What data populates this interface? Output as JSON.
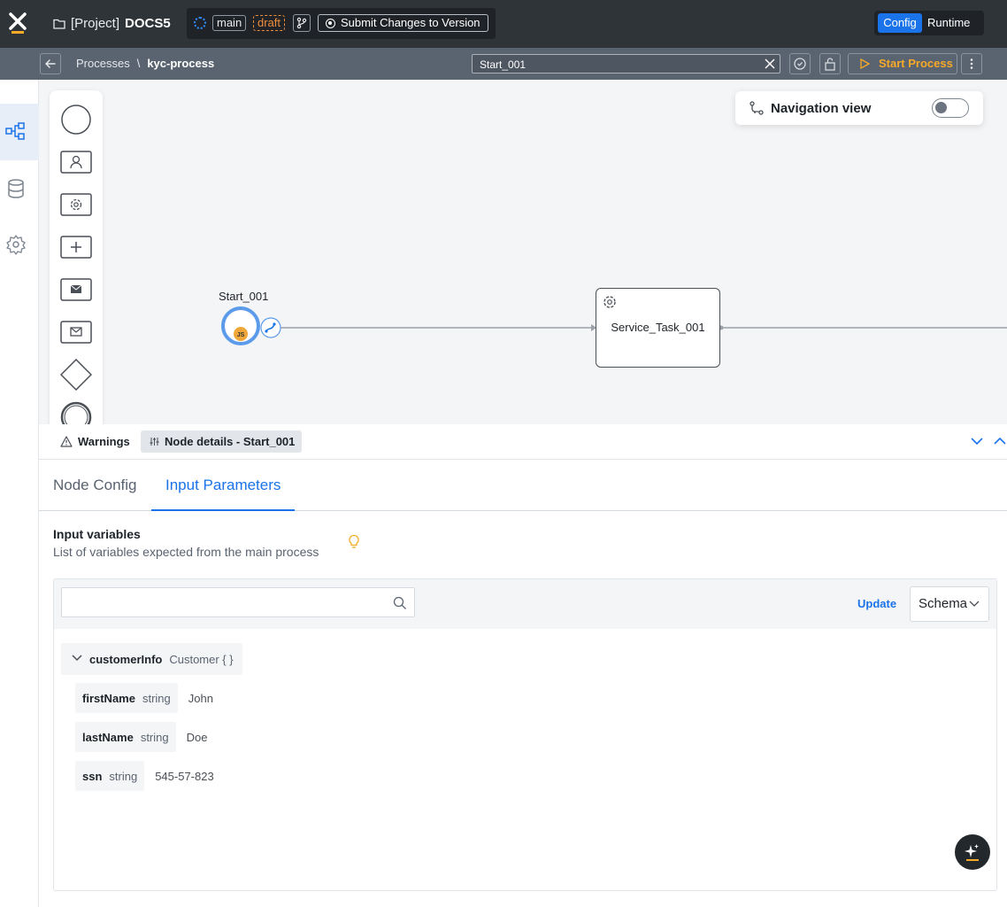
{
  "header": {
    "project_prefix": "[Project]",
    "project_name": "DOCS5",
    "branch": "main",
    "status": "draft",
    "submit_label": "Submit Changes to Version",
    "modes": [
      "Config",
      "Runtime"
    ],
    "active_mode": "Config",
    "accent_color": "#1a73e8"
  },
  "subheader": {
    "breadcrumb": [
      "Processes",
      "\\",
      "kyc-process"
    ],
    "node_search_value": "Start_001",
    "start_label": "Start Process",
    "start_color": "#f7a928"
  },
  "sidebar": {
    "items": [
      {
        "icon": "process-diagram-icon",
        "active": true
      },
      {
        "icon": "database-icon",
        "active": false
      },
      {
        "icon": "gear-icon",
        "active": false
      }
    ]
  },
  "canvas": {
    "navigation_view_label": "Navigation view",
    "navigation_view_enabled": false,
    "palette": [
      "start-event-icon",
      "user-task-icon",
      "service-task-icon",
      "subprocess-icon",
      "send-message-icon",
      "receive-message-icon",
      "gateway-icon",
      "end-event-icon"
    ],
    "start_node": {
      "label": "Start_001",
      "badge": "JS"
    },
    "service_node": {
      "label": "Service_Task_001"
    }
  },
  "panel": {
    "warnings_label": "Warnings",
    "node_details_label": "Node details - Start_001",
    "tabs": [
      "Node Config",
      "Input Parameters"
    ],
    "active_tab": "Input Parameters"
  },
  "input_variables": {
    "title": "Input variables",
    "subtitle": "List of variables expected from the main process",
    "search_placeholder": "",
    "update_label": "Update",
    "view_mode": "Schema",
    "object": {
      "name": "customerInfo",
      "type": "Customer { }"
    },
    "fields": [
      {
        "name": "firstName",
        "type": "string",
        "value": "John"
      },
      {
        "name": "lastName",
        "type": "string",
        "value": "Doe"
      },
      {
        "name": "ssn",
        "type": "string",
        "value": "545-57-823"
      }
    ]
  }
}
